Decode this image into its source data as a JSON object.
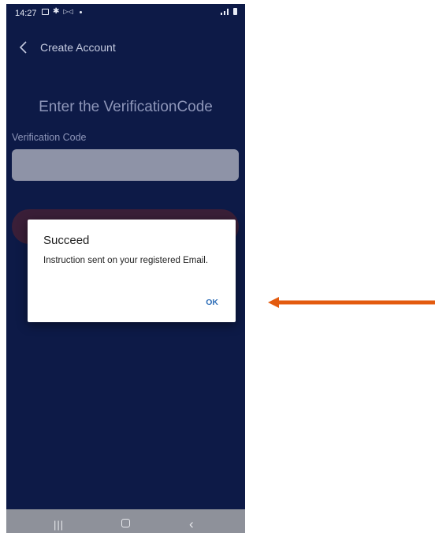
{
  "status_bar": {
    "time": "14:27",
    "icons": [
      "gallery-icon",
      "gear-icon",
      "mail-icon",
      "dot-icon",
      "signal-icon",
      "battery-icon"
    ]
  },
  "app_bar": {
    "back_icon": "chevron-left-icon",
    "title": "Create Account"
  },
  "form": {
    "heading": "Enter the VerificationCode",
    "field_label": "Verification Code",
    "field_value": ""
  },
  "dialog": {
    "title": "Succeed",
    "message": "Instruction sent on your registered Email.",
    "ok_label": "OK"
  },
  "nav_bar": {
    "recents_icon": "|||",
    "home_icon": "home-icon",
    "back_icon": "‹"
  },
  "colors": {
    "screen_bg": "#0d1a47",
    "dialog_bg": "#ffffff",
    "ok_text": "#2f6fb8",
    "annotation_arrow": "#e35b0f",
    "nav_bar_bg": "#8e919a"
  }
}
